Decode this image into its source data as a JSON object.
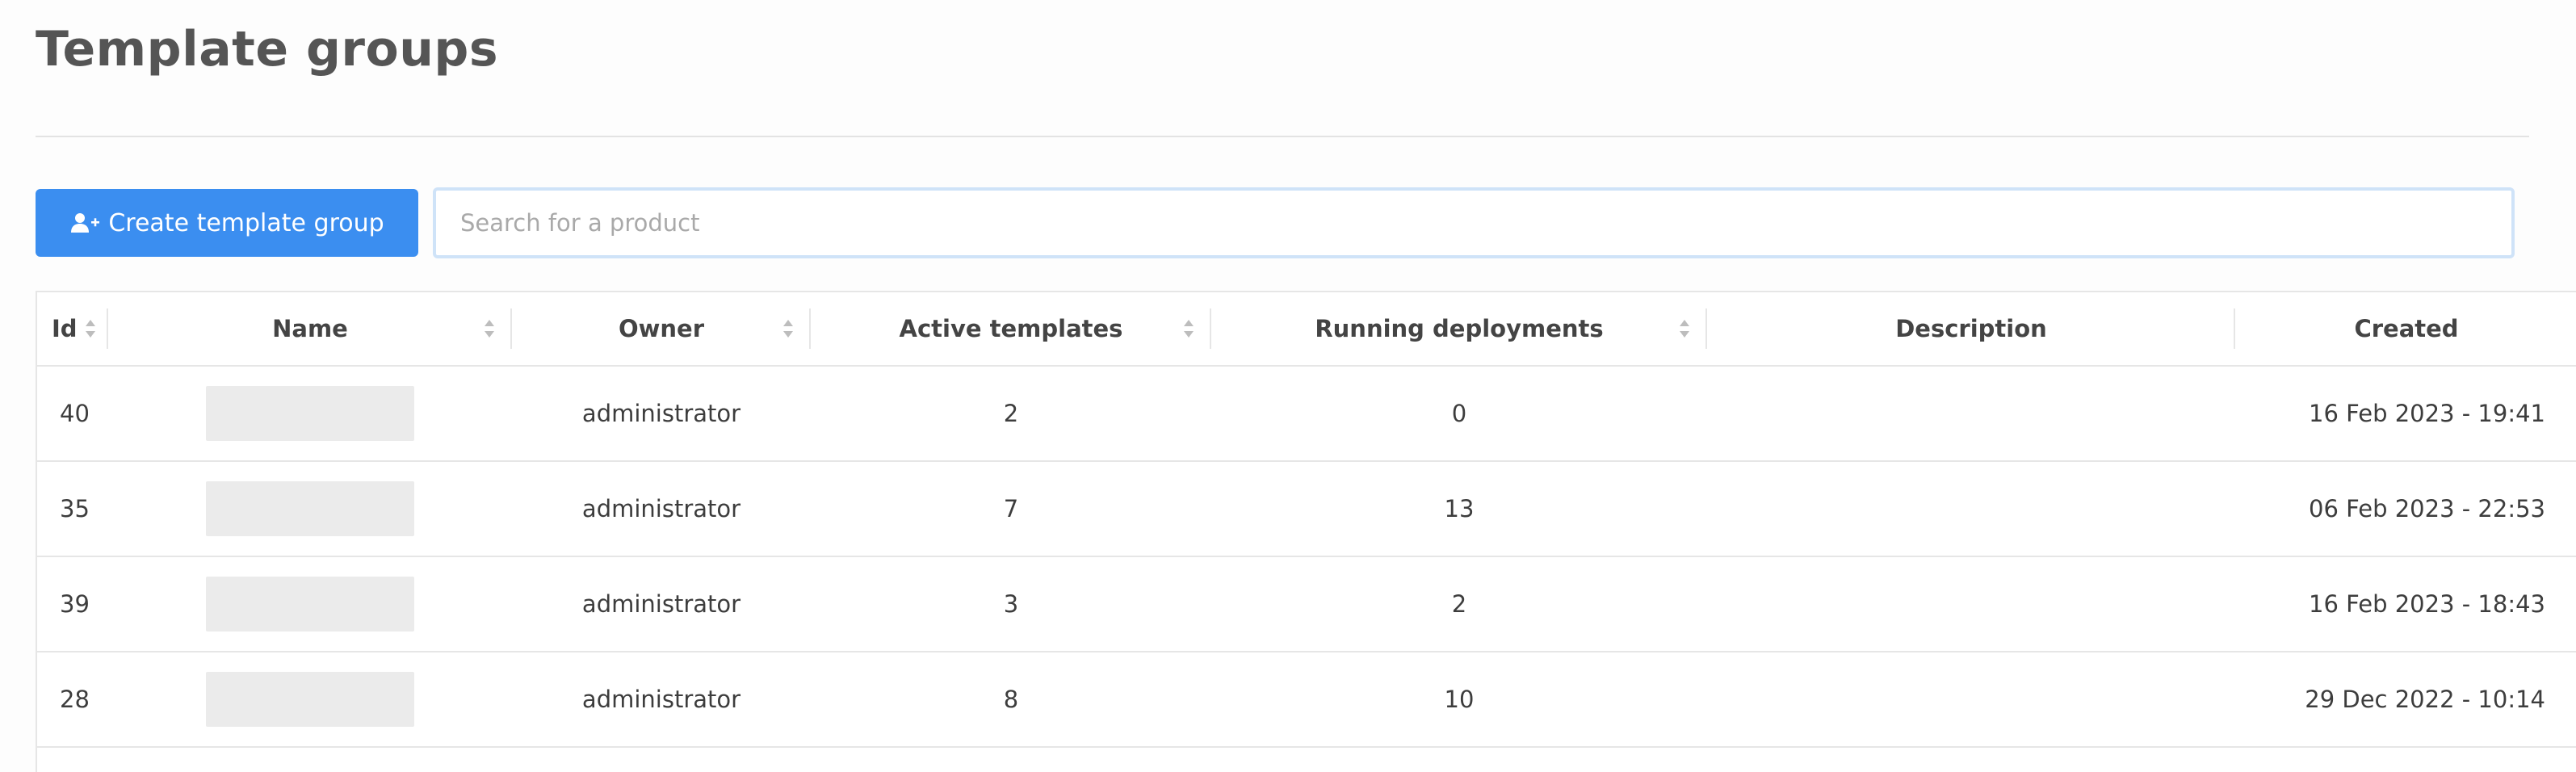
{
  "page": {
    "title": "Template groups"
  },
  "toolbar": {
    "create_label": "Create template group",
    "create_icon": "add-user-icon",
    "search_placeholder": "Search for a product",
    "search_value": ""
  },
  "table": {
    "columns": [
      {
        "key": "id",
        "label": "Id",
        "sortable": true
      },
      {
        "key": "name",
        "label": "Name",
        "sortable": true
      },
      {
        "key": "owner",
        "label": "Owner",
        "sortable": true
      },
      {
        "key": "active_templates",
        "label": "Active templates",
        "sortable": true
      },
      {
        "key": "running_deployments",
        "label": "Running deployments",
        "sortable": true
      },
      {
        "key": "description",
        "label": "Description",
        "sortable": false
      },
      {
        "key": "created",
        "label": "Created",
        "sortable": false
      }
    ],
    "rows": [
      {
        "id": "40",
        "name": "",
        "owner": "administrator",
        "active_templates": "2",
        "running_deployments": "0",
        "description": "",
        "created": "16 Feb 2023 - 19:41"
      },
      {
        "id": "35",
        "name": "",
        "owner": "administrator",
        "active_templates": "7",
        "running_deployments": "13",
        "description": "",
        "created": "06 Feb 2023 - 22:53"
      },
      {
        "id": "39",
        "name": "",
        "owner": "administrator",
        "active_templates": "3",
        "running_deployments": "2",
        "description": "",
        "created": "16 Feb 2023 - 18:43"
      },
      {
        "id": "28",
        "name": "",
        "owner": "administrator",
        "active_templates": "8",
        "running_deployments": "10",
        "description": "",
        "created": "29 Dec 2022 - 10:14"
      }
    ]
  },
  "colors": {
    "accent": "#3b8ef0",
    "search_border": "#cfe3f8",
    "divider": "#e6e6e6"
  }
}
